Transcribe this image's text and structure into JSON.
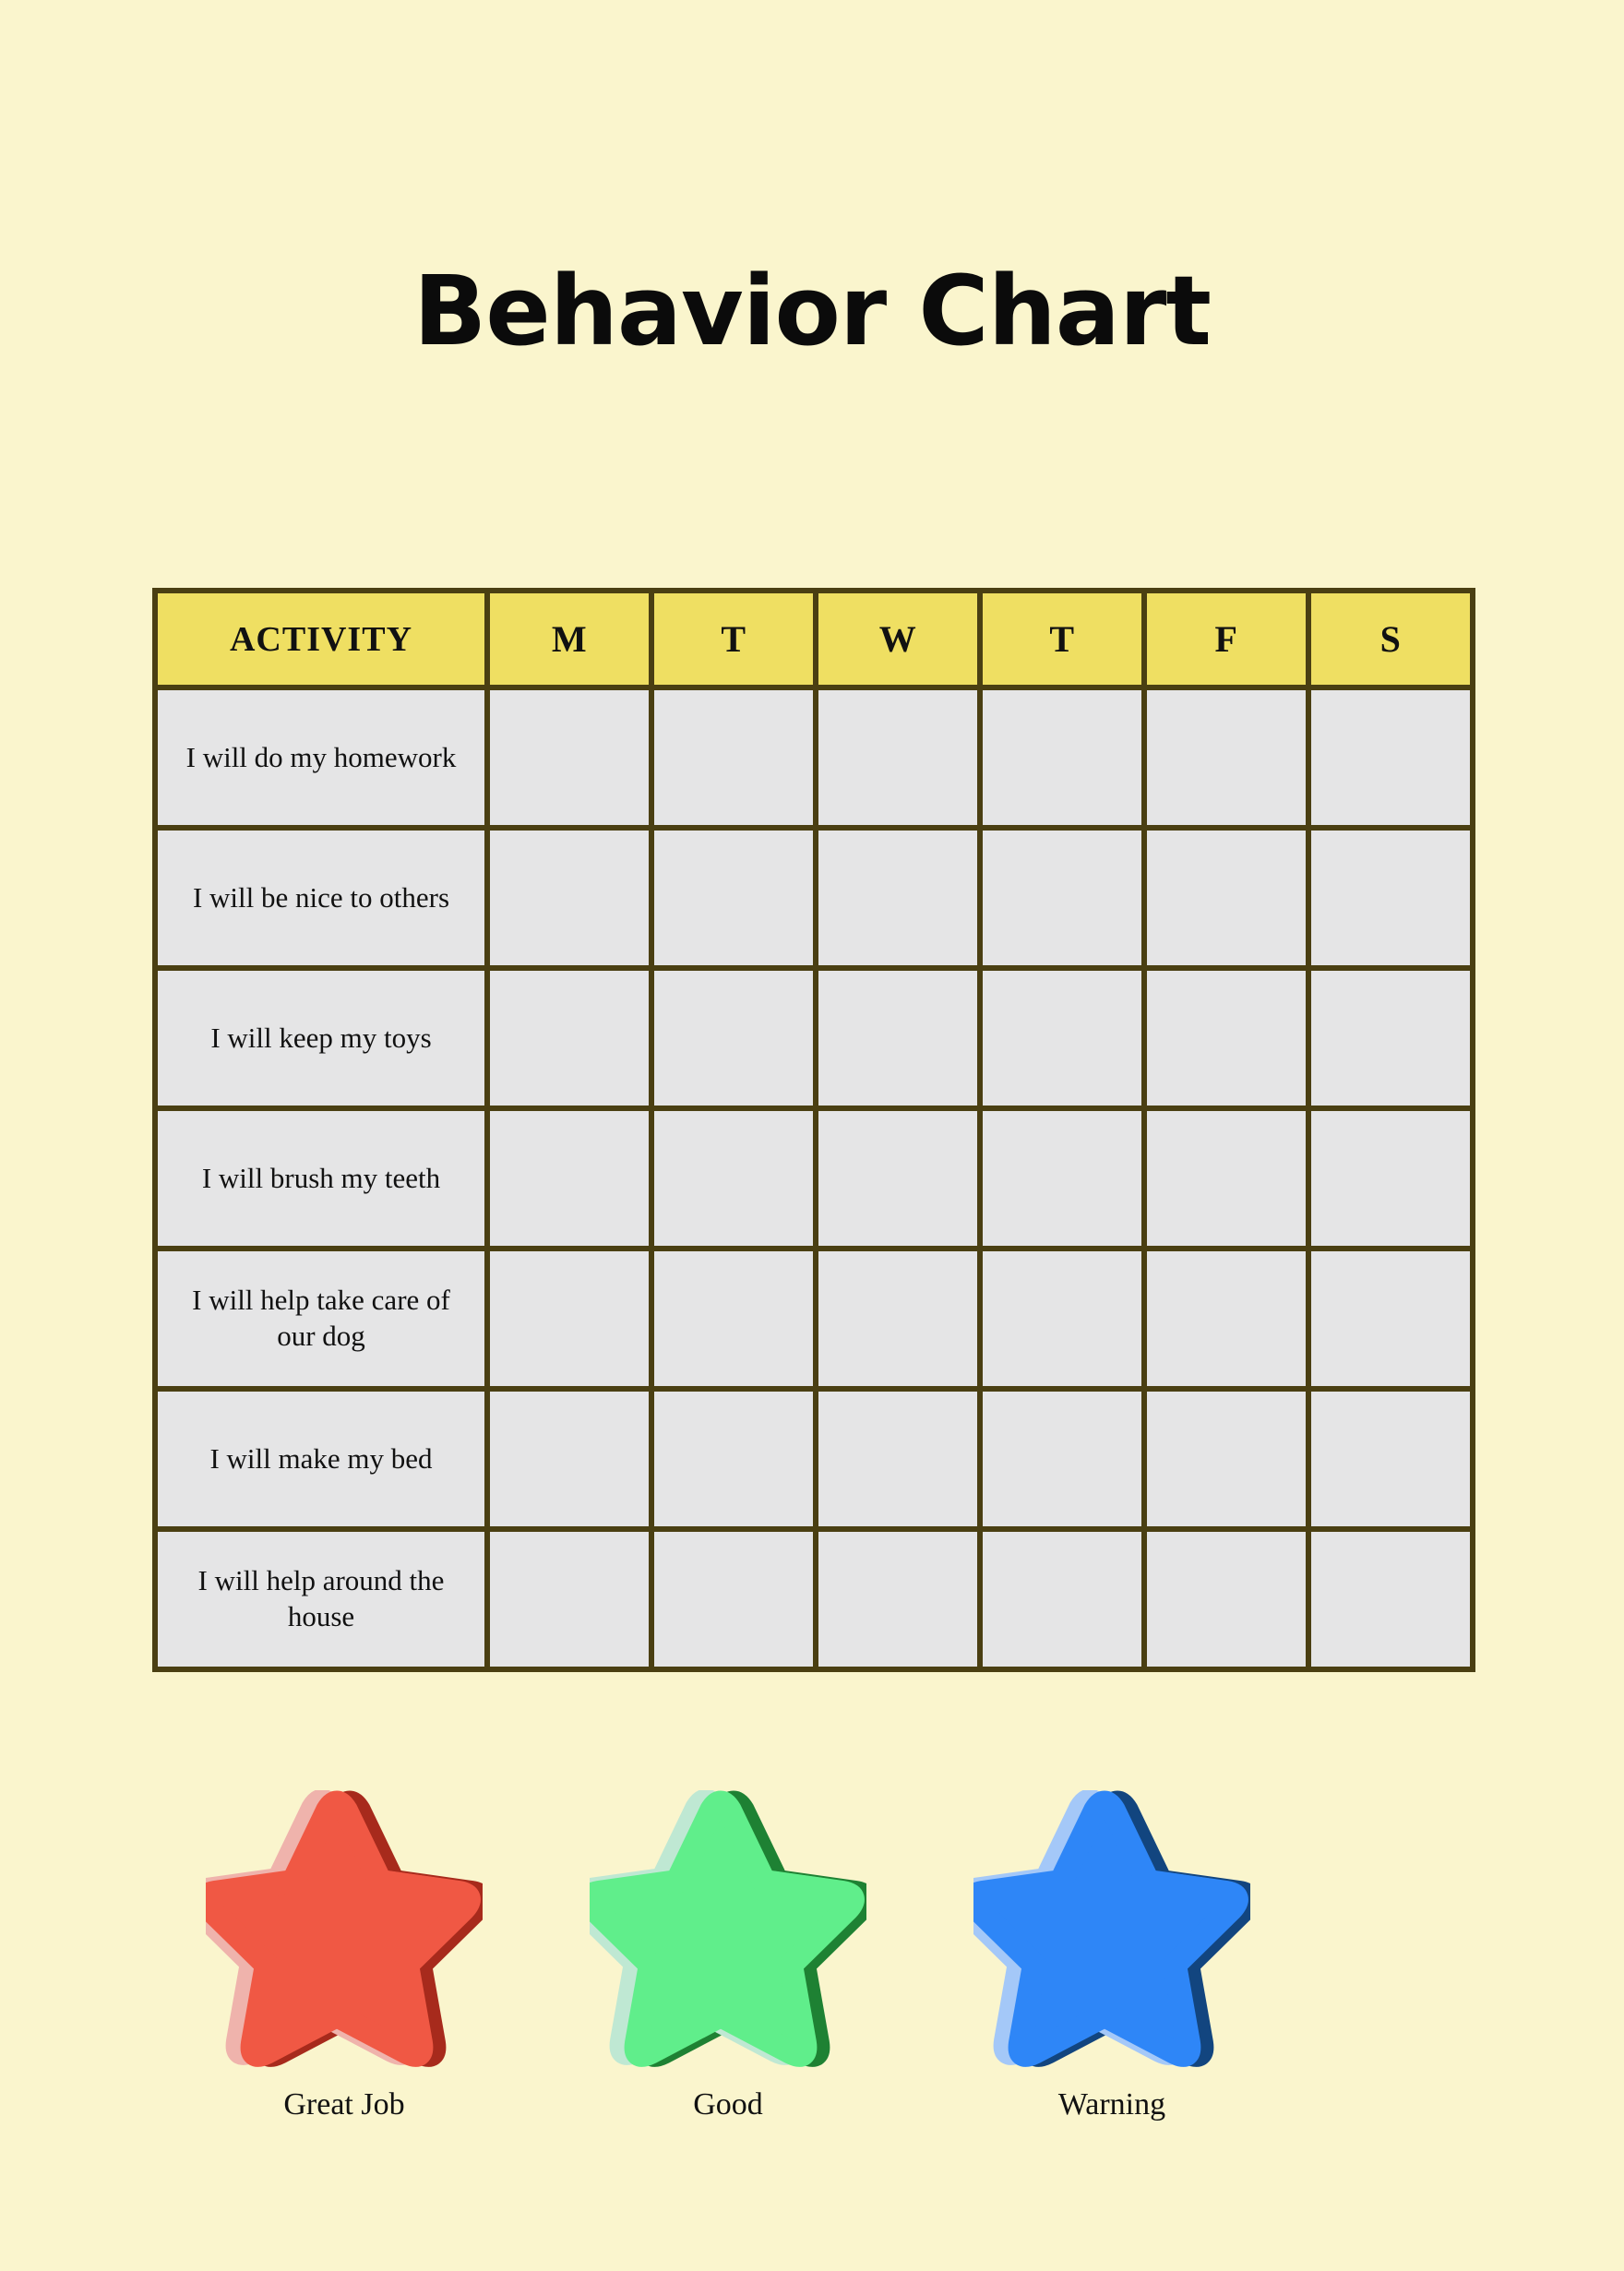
{
  "page": {
    "title": "Behavior Chart",
    "background_color": "#FAF5CD"
  },
  "table": {
    "header_background": "#EFDF62",
    "cell_background": "#E5E5E6",
    "border_color": "#4A3F12",
    "headers": [
      "ACTIVITY",
      "M",
      "T",
      "W",
      "T",
      "F",
      "S"
    ],
    "rows": [
      {
        "activity": "I will do my homework",
        "marks": [
          "",
          "",
          "",
          "",
          "",
          ""
        ]
      },
      {
        "activity": "I will be nice to others",
        "marks": [
          "",
          "",
          "",
          "",
          "",
          ""
        ]
      },
      {
        "activity": "I will keep my toys",
        "marks": [
          "",
          "",
          "",
          "",
          "",
          ""
        ]
      },
      {
        "activity": "I will brush my teeth",
        "marks": [
          "",
          "",
          "",
          "",
          "",
          ""
        ]
      },
      {
        "activity": "I will help take care of our dog",
        "marks": [
          "",
          "",
          "",
          "",
          "",
          ""
        ]
      },
      {
        "activity": "I will make my bed",
        "marks": [
          "",
          "",
          "",
          "",
          "",
          ""
        ]
      },
      {
        "activity": "I will help around the house",
        "marks": [
          "",
          "",
          "",
          "",
          "",
          ""
        ]
      }
    ]
  },
  "legend": {
    "items": [
      {
        "label": "Great Job",
        "icon": "star-icon",
        "main_color": "#F05844",
        "highlight_color": "#EFB3AC",
        "shadow_color": "#A72A1C"
      },
      {
        "label": "Good",
        "icon": "star-icon",
        "main_color": "#60EE8B",
        "highlight_color": "#BFE8D3",
        "shadow_color": "#1E8133"
      },
      {
        "label": "Warning",
        "icon": "star-icon",
        "main_color": "#2E86F7",
        "highlight_color": "#A4C8F8",
        "shadow_color": "#12457F"
      }
    ]
  }
}
